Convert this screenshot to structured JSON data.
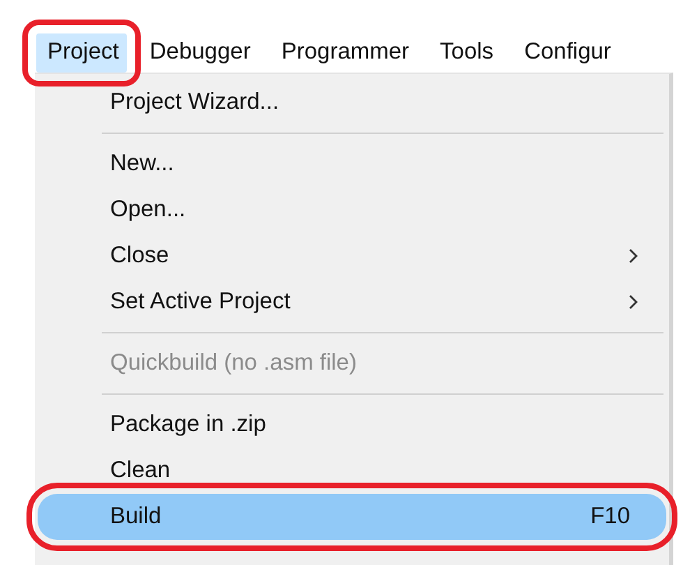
{
  "menu_bar": [
    {
      "label": "Project",
      "selected": true,
      "circled": true
    },
    {
      "label": "Debugger",
      "selected": false,
      "circled": false
    },
    {
      "label": "Programmer",
      "selected": false,
      "circled": false
    },
    {
      "label": "Tools",
      "selected": false,
      "circled": false
    },
    {
      "label": "Configur",
      "selected": false,
      "circled": false
    }
  ],
  "dropdown": [
    {
      "kind": "item",
      "label": "Project Wizard...",
      "submenu": false,
      "disabled": false,
      "selected": false,
      "circled": false
    },
    {
      "kind": "separator"
    },
    {
      "kind": "item",
      "label": "New...",
      "submenu": false,
      "disabled": false,
      "selected": false,
      "circled": false
    },
    {
      "kind": "item",
      "label": "Open...",
      "submenu": false,
      "disabled": false,
      "selected": false,
      "circled": false
    },
    {
      "kind": "item",
      "label": "Close",
      "submenu": true,
      "disabled": false,
      "selected": false,
      "circled": false
    },
    {
      "kind": "item",
      "label": "Set Active Project",
      "submenu": true,
      "disabled": false,
      "selected": false,
      "circled": false
    },
    {
      "kind": "separator"
    },
    {
      "kind": "item",
      "label": "Quickbuild (no .asm file)",
      "submenu": false,
      "disabled": true,
      "selected": false,
      "circled": false
    },
    {
      "kind": "separator"
    },
    {
      "kind": "item",
      "label": "Package in .zip",
      "submenu": false,
      "disabled": false,
      "selected": false,
      "circled": false
    },
    {
      "kind": "item",
      "label": "Clean",
      "submenu": false,
      "disabled": false,
      "selected": false,
      "circled": false
    },
    {
      "kind": "item",
      "label": "Build",
      "shortcut": "F10",
      "submenu": false,
      "disabled": false,
      "selected": true,
      "circled": true
    }
  ]
}
